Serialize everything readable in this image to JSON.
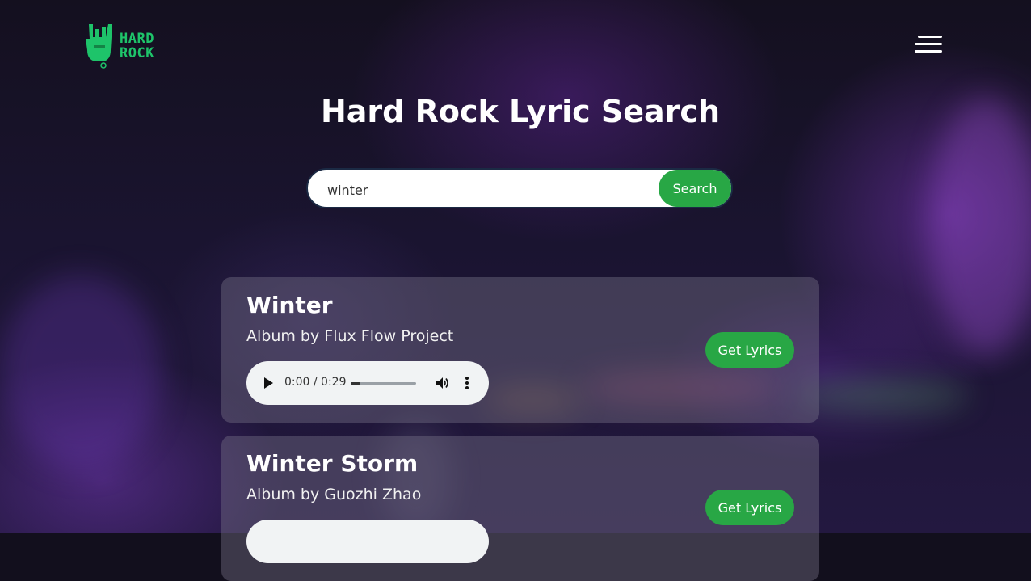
{
  "header": {
    "logo_line1": "HARD",
    "logo_line2": "ROCK",
    "logo_icon": "rock-hand-icon",
    "menu_icon": "hamburger-menu-icon"
  },
  "page": {
    "title": "Hard Rock Lyric Search"
  },
  "search": {
    "value": "winter",
    "button_label": "Search"
  },
  "results": [
    {
      "title": "Winter",
      "album_line": "Album by Flux Flow Project",
      "player_time": "0:00 / 0:29",
      "progress": 0.15,
      "button_label": "Get Lyrics"
    },
    {
      "title": "Winter Storm",
      "album_line": "Album by Guozhi Zhao",
      "button_label": "Get Lyrics"
    }
  ],
  "colors": {
    "accent": "#28a745",
    "logo": "#1ec46a",
    "card": "#6f6b7d"
  }
}
